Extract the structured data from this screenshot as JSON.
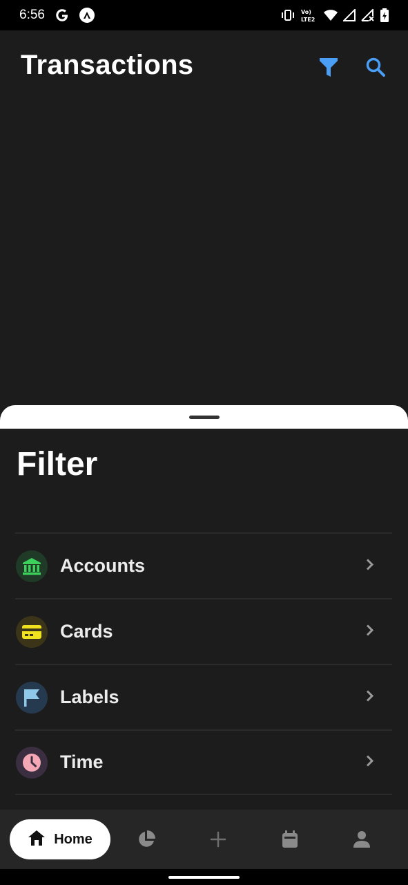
{
  "status_bar": {
    "time": "6:56",
    "network_label": "Vo) LTE2",
    "icons": [
      "google-icon",
      "app-icon",
      "vibrate-icon",
      "volte-icon",
      "wifi-icon",
      "signal-icon",
      "signal-x-icon",
      "battery-icon"
    ]
  },
  "header": {
    "title": "Transactions",
    "icons": [
      "filter-icon",
      "search-icon"
    ],
    "accent": "#4a9ff5"
  },
  "sheet": {
    "title": "Filter",
    "items": [
      {
        "label": "Accounts",
        "icon": "bank-icon",
        "icon_color": "#3bd15a",
        "icon_bg": "#1f3a26"
      },
      {
        "label": "Cards",
        "icon": "card-icon",
        "icon_color": "#f0e21f",
        "icon_bg": "#3b3418"
      },
      {
        "label": "Labels",
        "icon": "flag-icon",
        "icon_color": "#8ec9ea",
        "icon_bg": "#263a4f"
      },
      {
        "label": "Time",
        "icon": "clock-icon",
        "icon_color": "#f4a7b5",
        "icon_bg": "#3a2e40"
      }
    ]
  },
  "bottom_nav": {
    "items": [
      {
        "label": "Home",
        "icon": "home-icon",
        "active": true
      },
      {
        "label": "",
        "icon": "pie-chart-icon",
        "active": false
      },
      {
        "label": "",
        "icon": "plus-icon",
        "active": false
      },
      {
        "label": "",
        "icon": "calendar-icon",
        "active": false
      },
      {
        "label": "",
        "icon": "person-icon",
        "active": false
      }
    ]
  }
}
